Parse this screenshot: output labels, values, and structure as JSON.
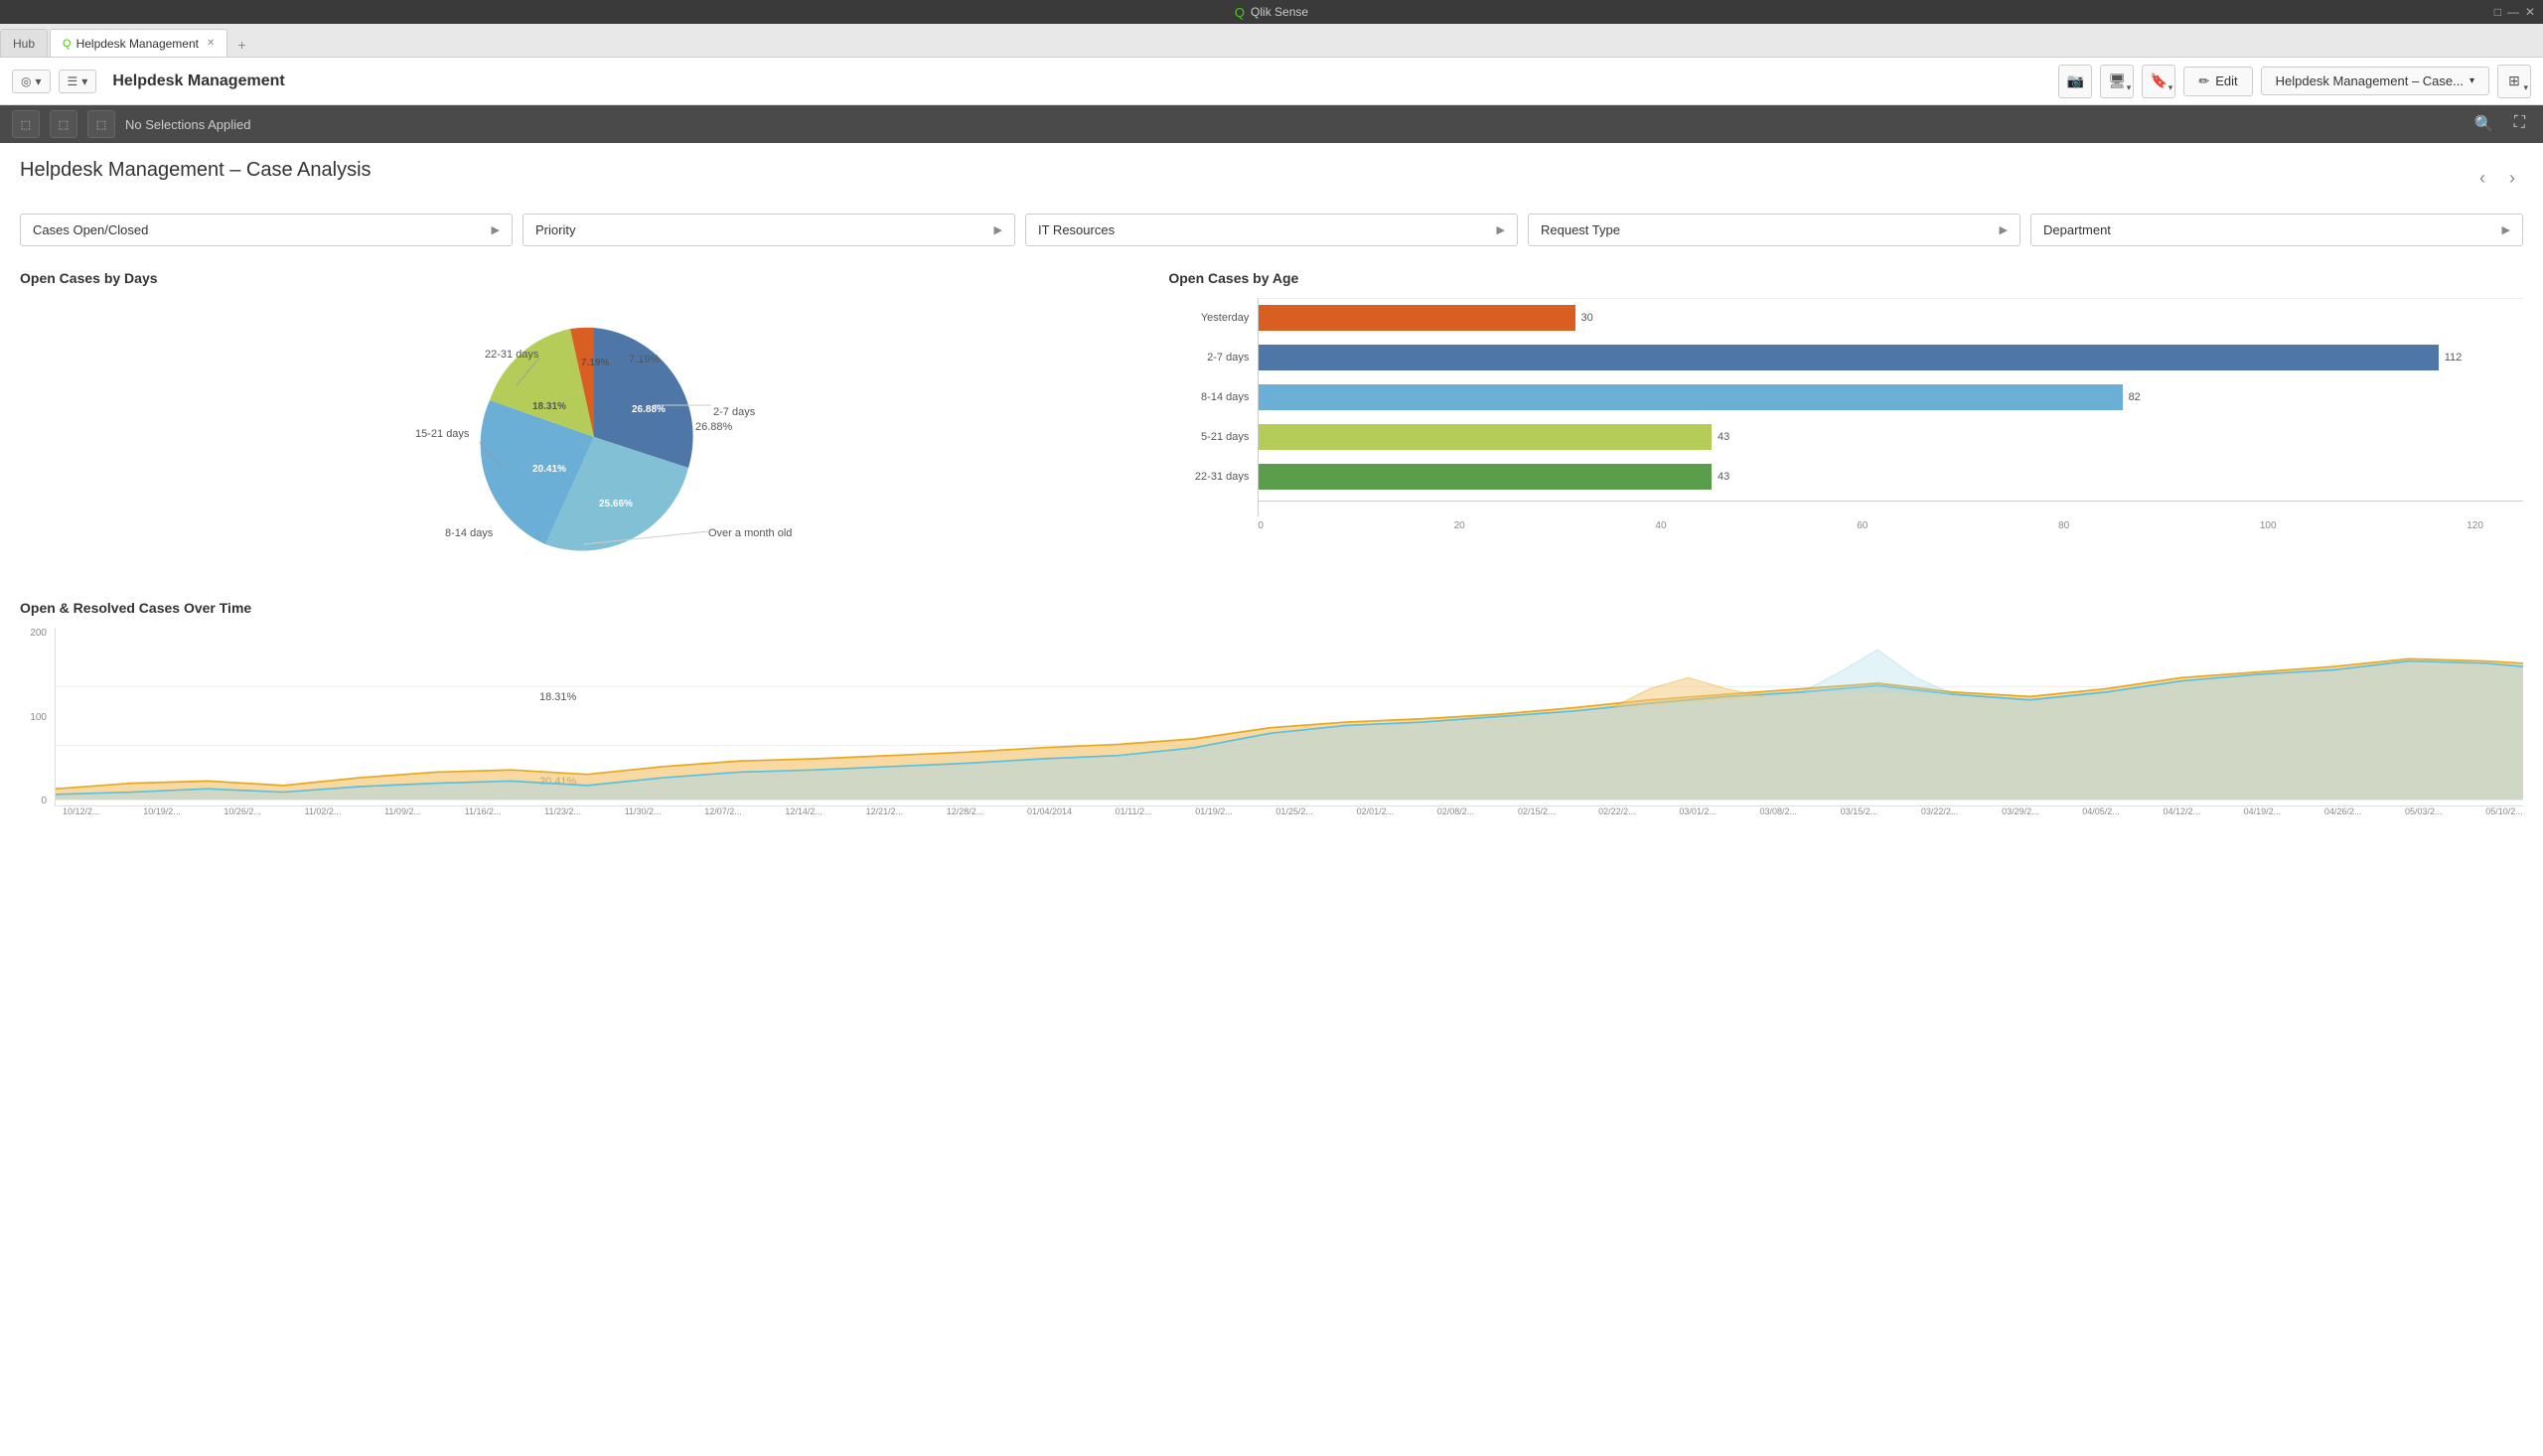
{
  "titleBar": {
    "title": "Qlik Sense",
    "controls": [
      "□",
      "—",
      "✕"
    ]
  },
  "tabs": [
    {
      "id": "hub",
      "label": "Hub",
      "active": false,
      "hasIcon": false
    },
    {
      "id": "helpdesk",
      "label": "Helpdesk Management",
      "active": true,
      "hasIcon": true
    }
  ],
  "toolbar": {
    "title": "Helpdesk Management",
    "editLabel": "Edit",
    "appName": "Helpdesk Management – Case...",
    "icons": [
      "📷",
      "🖥",
      "🔖",
      "✏"
    ]
  },
  "selectionBar": {
    "text": "No Selections Applied",
    "buttons": [
      "⬚",
      "⬚",
      "⬚"
    ]
  },
  "page": {
    "title": "Helpdesk Management – Case Analysis"
  },
  "filters": [
    {
      "label": "Cases Open/Closed",
      "id": "cases-open-closed"
    },
    {
      "label": "Priority",
      "id": "priority"
    },
    {
      "label": "IT Resources",
      "id": "it-resources"
    },
    {
      "label": "Request Type",
      "id": "request-type"
    },
    {
      "label": "Department",
      "id": "department"
    }
  ],
  "pieChart": {
    "title": "Open Cases by Days",
    "segments": [
      {
        "label": "2-7 days",
        "value": 26.88,
        "color": "#4e77a8",
        "startAngle": 0
      },
      {
        "label": "Over a month old",
        "value": 25.66,
        "color": "#81c0d5",
        "startAngle": 96.768
      },
      {
        "label": "8-14 days",
        "value": 20.41,
        "color": "#6baed6",
        "startAngle": 189.144
      },
      {
        "label": "15-21 days",
        "value": 18.31,
        "color": "#b5cc59",
        "startAngle": 262.644
      },
      {
        "label": "22-31 days",
        "value": 7.19,
        "color": "#d85e22",
        "startAngle": 328.56
      }
    ]
  },
  "barChart": {
    "title": "Open Cases by Age",
    "bars": [
      {
        "label": "Yesterday",
        "value": 30,
        "maxValue": 120,
        "color": "#d85e22"
      },
      {
        "label": "2-7 days",
        "value": 112,
        "maxValue": 120,
        "color": "#4e77a8"
      },
      {
        "label": "8-14 days",
        "value": 82,
        "maxValue": 120,
        "color": "#6baed6"
      },
      {
        "label": "5-21 days",
        "value": 43,
        "maxValue": 120,
        "color": "#b5cc59"
      },
      {
        "label": "22-31 days",
        "value": 43,
        "maxValue": 120,
        "color": "#5a9e4b"
      }
    ],
    "axisLabels": [
      "0",
      "20",
      "40",
      "60",
      "80",
      "100",
      "120"
    ]
  },
  "timeChart": {
    "title": "Open & Resolved Cases Over Time",
    "yAxis": [
      "200",
      "100",
      "0"
    ],
    "xLabels": [
      "10/12/2..",
      "10/19/2..",
      "10/26/2..",
      "11/02/2..",
      "11/09/2..",
      "11/16/2..",
      "11/23/2..",
      "11/30/2..",
      "12/07/2..",
      "12/14/2..",
      "12/21/2..",
      "12/28/2..",
      "01/04/2014",
      "01/11/2..",
      "01/19/2..",
      "01/25/2..",
      "02/01/2..",
      "02/08/2..",
      "02/15/2..",
      "02/22/2..",
      "03/01/2..",
      "03/08/2..",
      "03/15/2..",
      "03/22/2..",
      "03/29/2..",
      "04/05/2..",
      "04/12/2..",
      "04/19/2..",
      "04/26/2..",
      "05/03/2..",
      "05/10/2.."
    ]
  }
}
